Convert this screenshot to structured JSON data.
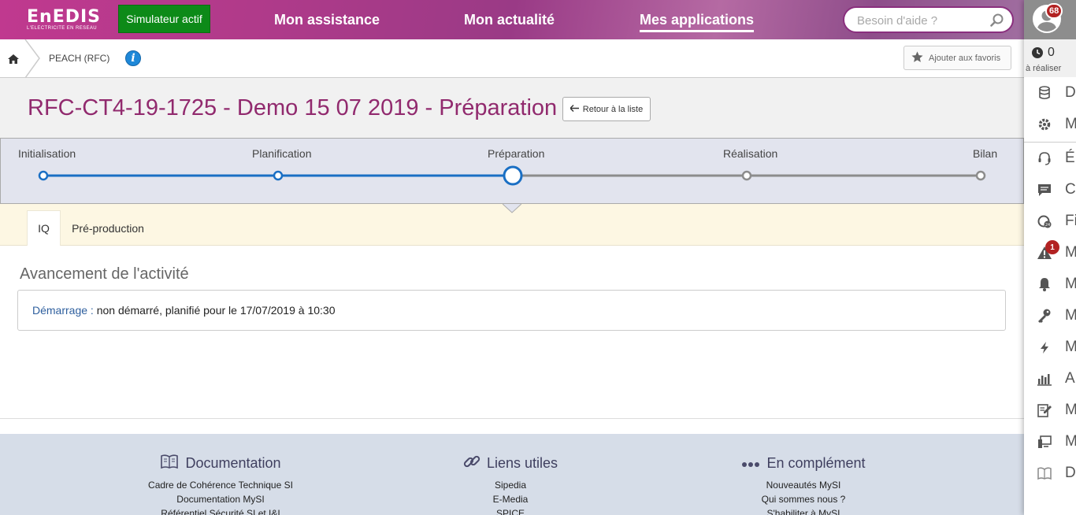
{
  "header": {
    "logo_main": "EnEDIS",
    "logo_sub": "L'ELECTRICITE EN RESEAU",
    "simulator_label": "Simulateur actif",
    "nav": [
      {
        "label": "Mon assistance"
      },
      {
        "label": "Mon actualité"
      },
      {
        "label": "Mes applications",
        "active": true
      }
    ],
    "search_placeholder": "Besoin d'aide ?"
  },
  "user": {
    "notifications": "68"
  },
  "todo": {
    "count": "0",
    "label": "à réaliser"
  },
  "sidebar_menu": [
    {
      "icon": "database-icon",
      "letter": "D"
    },
    {
      "icon": "gear-icon",
      "letter": "M"
    },
    {
      "icon": "headset-icon",
      "letter": "É"
    },
    {
      "icon": "chat-icon",
      "letter": "C"
    },
    {
      "icon": "hour24-icon",
      "letter": "Fi"
    },
    {
      "icon": "warning-icon",
      "letter": "M",
      "badge": "1"
    },
    {
      "icon": "bell-icon",
      "letter": "M"
    },
    {
      "icon": "key-icon",
      "letter": "M"
    },
    {
      "icon": "lightning-icon",
      "letter": "M"
    },
    {
      "icon": "chart-icon",
      "letter": "A"
    },
    {
      "icon": "edit-icon",
      "letter": "M"
    },
    {
      "icon": "monitor-icon",
      "letter": "M"
    },
    {
      "icon": "book-icon",
      "letter": "D"
    }
  ],
  "breadcrumb": {
    "item": "PEACH (RFC)",
    "favorite_label": "Ajouter aux favoris"
  },
  "page": {
    "title": "RFC-CT4-19-1725 - Demo 15 07 2019 - Préparation",
    "back_label": "Retour à la liste"
  },
  "steps": {
    "items": [
      "Initialisation",
      "Planification",
      "Préparation",
      "Réalisation",
      "Bilan"
    ],
    "current": "Préparation",
    "colors": {
      "done": "#1a6fc4",
      "todo": "#8c8c8c"
    }
  },
  "tabs": [
    "IQ",
    "Pré-production"
  ],
  "activity": {
    "heading": "Avancement de l'activité",
    "key": "Démarrage :",
    "value": "non démarré, planifié pour le 17/07/2019 à 10:30"
  },
  "footer": {
    "columns": [
      {
        "title": "Documentation",
        "icon": "book-icon",
        "links": [
          "Cadre de Cohérence Technique SI",
          "Documentation MySI",
          "Référentiel Sécurité SI et I&I"
        ]
      },
      {
        "title": "Liens utiles",
        "icon": "link-icon",
        "links": [
          "Sipedia",
          "E-Media",
          "SPICE"
        ]
      },
      {
        "title": "En complément",
        "icon": "dots-icon",
        "links": [
          "Nouveautés MySI",
          "Qui sommes nous ?",
          "S'habiliter à MySI"
        ]
      }
    ]
  }
}
